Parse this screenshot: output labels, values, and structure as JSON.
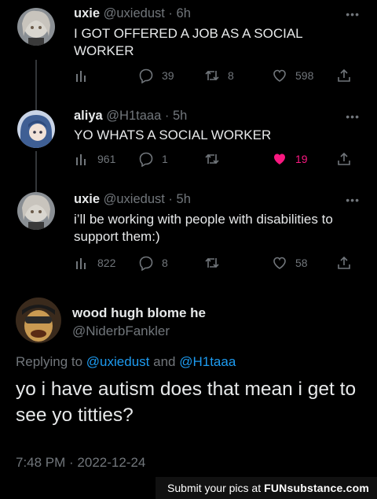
{
  "tweets": [
    {
      "name": "uxie",
      "handle": "@uxiedust",
      "time": "6h",
      "text": "I GOT OFFERED A JOB AS A SOCIAL WORKER",
      "views": "",
      "replies": "39",
      "retweets": "8",
      "likes": "598",
      "liked": false
    },
    {
      "name": "aliya",
      "handle": "@H1taaa",
      "time": "5h",
      "text": "YO WHATS A SOCIAL WORKER",
      "views": "961",
      "replies": "1",
      "retweets": "",
      "likes": "19",
      "liked": true
    },
    {
      "name": "uxie",
      "handle": "@uxiedust",
      "time": "5h",
      "text": "i’ll be working with people with disabilities to support them:)",
      "views": "822",
      "replies": "8",
      "retweets": "",
      "likes": "58",
      "liked": false
    }
  ],
  "main": {
    "name": "wood hugh blome he",
    "handle": "@NiderbFankler",
    "replying_prefix": "Replying to",
    "mention1": "@uxiedust",
    "and": "and",
    "mention2": "@H1taaa",
    "text": "yo i have autism does that mean i get to see yo titties?",
    "timestamp": "7:48 PM · 2022-12-24"
  },
  "footer": {
    "text": "Submit your pics at",
    "brand": "FUNsubstance.com"
  },
  "colors": {
    "background": "#000000",
    "like_pink": "#f91880",
    "mention_blue": "#1d9bf0",
    "muted": "#71767b"
  }
}
